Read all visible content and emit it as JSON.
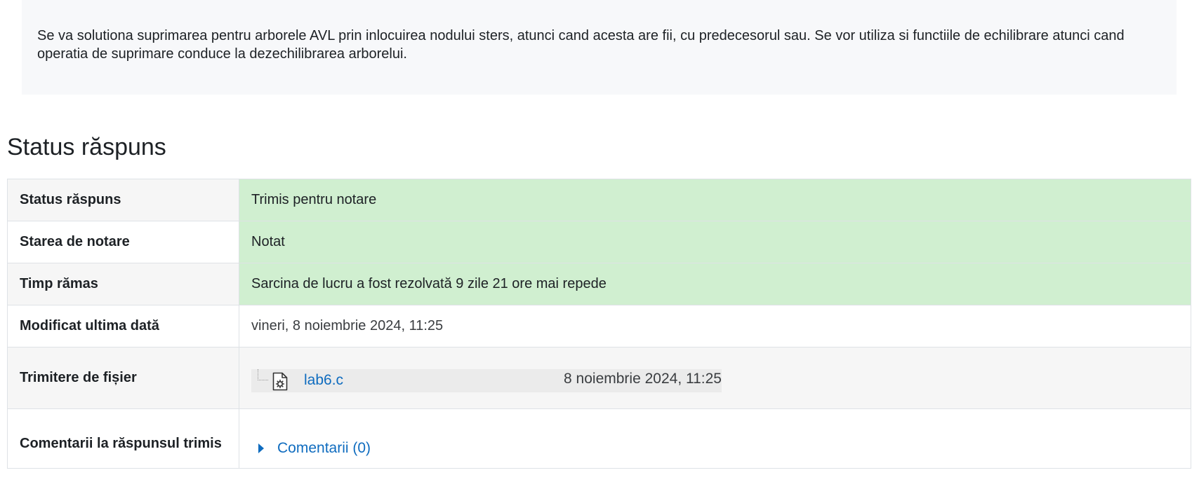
{
  "intro": {
    "text": "Se va solutiona suprimarea pentru arborele AVL prin inlocuirea nodului sters, atunci cand acesta are fii, cu predecesorul sau. Se vor utiliza si functiile de echilibrare atunci cand operatia de suprimare conduce la dezechilibrarea arborelui."
  },
  "section": {
    "title": "Status răspuns"
  },
  "table": {
    "rows": [
      {
        "label": "Status răspuns",
        "value": "Trimis pentru notare"
      },
      {
        "label": "Starea de notare",
        "value": "Notat"
      },
      {
        "label": "Timp rămas",
        "value": "Sarcina de lucru a fost rezolvată 9 zile 21 ore mai repede"
      },
      {
        "label": "Modificat ultima dată",
        "value": "vineri, 8 noiembrie 2024, 11:25"
      },
      {
        "label": "Trimitere de fișier",
        "file_name": "lab6.c",
        "file_date": "8 noiembrie 2024, 11:25",
        "file_icon": "file-code-icon"
      },
      {
        "label": "Comentarii la răspunsul trimis",
        "comments_label": "Comentarii (0)",
        "toggle_icon": "caret-right-icon"
      }
    ]
  },
  "colors": {
    "success_bg": "#d0efd0",
    "link": "#0f6cbf",
    "intro_bg": "#f7f8fa"
  }
}
